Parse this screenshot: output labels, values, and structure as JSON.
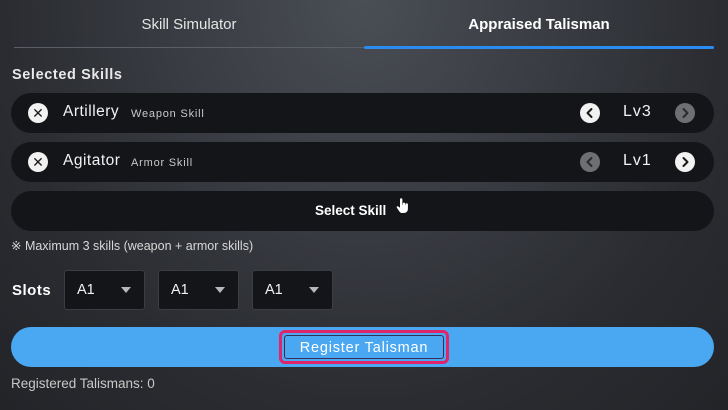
{
  "tabs": [
    {
      "label": "Skill Simulator",
      "active": false
    },
    {
      "label": "Appraised Talisman",
      "active": true
    }
  ],
  "selected_skills": {
    "title": "Selected Skills",
    "items": [
      {
        "name": "Artillery",
        "type": "Weapon Skill",
        "level": "Lv3",
        "dec_enabled": true,
        "inc_enabled": false
      },
      {
        "name": "Agitator",
        "type": "Armor Skill",
        "level": "Lv1",
        "dec_enabled": false,
        "inc_enabled": true
      }
    ],
    "remove_symbol": "✕"
  },
  "select_skill": {
    "label": "Select Skill",
    "icon": "hand-pointer-icon"
  },
  "note": "※ Maximum 3 skills (weapon + armor skills)",
  "slots": {
    "label": "Slots",
    "values": [
      "A1",
      "A1",
      "A1"
    ]
  },
  "register": {
    "label": "Register Talisman"
  },
  "registered": {
    "text": "Registered Talismans: 0"
  },
  "colors": {
    "accent": "#2a8cf0",
    "register_bar": "#4aa8f2",
    "highlight_border": "#e0246a",
    "row_bg": "#141518"
  }
}
